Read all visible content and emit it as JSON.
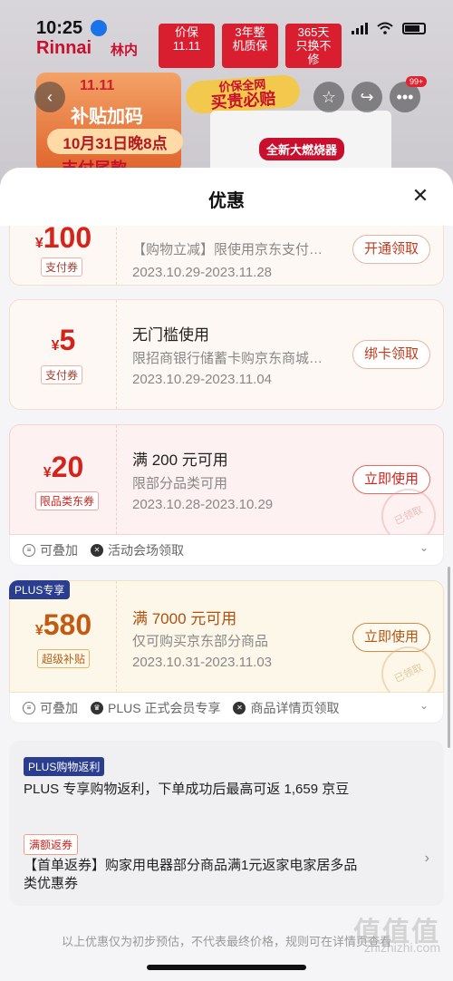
{
  "status_bar": {
    "time": "10:25"
  },
  "product_page": {
    "brand_logo": "Rinnai",
    "brand_cn": "林内",
    "promo_tags": [
      "价保\n11.11",
      "3年整\n机质保",
      "365天\n只换不修"
    ],
    "badge": "99+",
    "banner": {
      "event": "11.11",
      "subtitle": "补贴加码",
      "date_text": "10月31日晚8点",
      "pay_text": "支付尾款",
      "price_line1": "价保全网",
      "price_line2": "买贵必赔",
      "product_tag": "全新大燃烧器"
    }
  },
  "sheet": {
    "title": "优惠",
    "coupons": [
      {
        "amount_symbol": "¥",
        "amount": "100",
        "type": "支付券",
        "title": "",
        "desc": "【购物立减】限使用京东支付…",
        "date": "2023.10.29-2023.11.28",
        "button": "开通领取"
      },
      {
        "amount_symbol": "¥",
        "amount": "5",
        "type": "支付券",
        "title": "无门槛使用",
        "desc": "限招商银行储蓄卡购京东商城…",
        "date": "2023.10.29-2023.11.04",
        "button": "绑卡领取"
      },
      {
        "amount_symbol": "¥",
        "amount": "20",
        "type": "限品类东券",
        "title": "满 200 元可用",
        "desc": "限部分品类可用",
        "date": "2023.10.28-2023.10.29",
        "button": "立即使用",
        "stamp": "已领取",
        "footer": [
          "可叠加",
          "活动会场领取"
        ]
      },
      {
        "badge": "PLUS专享",
        "amount_symbol": "¥",
        "amount": "580",
        "type": "超级补贴",
        "title": "满 7000 元可用",
        "desc": "仅可购买京东部分商品",
        "date": "2023.10.31-2023.11.03",
        "button": "立即使用",
        "stamp": "已领取",
        "footer": [
          "可叠加",
          "PLUS 正式会员专享",
          "商品详情页领取"
        ]
      }
    ],
    "info": {
      "plus_badge": "PLUS购物返利",
      "plus_text": "PLUS 专享购物返利，下单成功后最高可返 1,659 京豆",
      "return_badge": "满额返券",
      "return_text": "【首单返券】购家用电器部分商品满1元返家电家居多品类优惠券"
    },
    "disclaimer": "以上优惠仅为初步预估，不代表最终价格，规则可在详情页查看",
    "watermark": "值值值",
    "watermark_sub": "zhizhizhi.com"
  }
}
